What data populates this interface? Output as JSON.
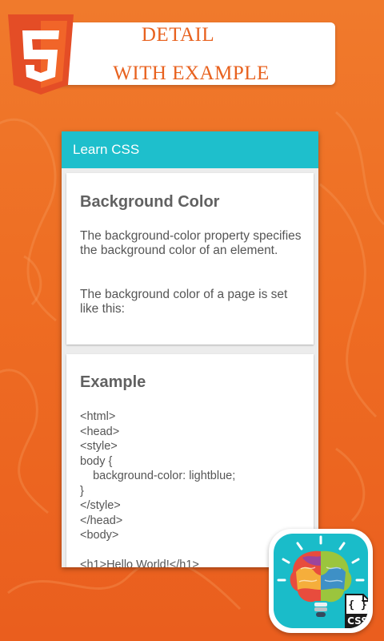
{
  "banner": {
    "line1": "DETAIL",
    "line2": "WITH EXAMPLE",
    "logo_icon": "html5-logo-icon",
    "logo_digit": "5"
  },
  "appbar": {
    "title": "Learn CSS"
  },
  "card_background": {
    "title": "Background Color",
    "paragraph1": "The background-color property specifies the background color of an element.",
    "paragraph2": "The background color of a page is set like this:"
  },
  "card_example": {
    "title": "Example",
    "code_lines": [
      "<html>",
      "<head>",
      "<style>",
      "body {",
      "    background-color: lightblue;",
      "}",
      "</style>",
      "</head>",
      "<body>",
      "",
      "<h1>Hello World!</h1>"
    ]
  },
  "badge": {
    "icon": "brain-lightbulb-icon",
    "file_icon": "css-file-icon",
    "file_label": "CSS",
    "file_braces": "{ }"
  },
  "colors": {
    "background": "#ee6d23",
    "banner_text": "#e8621f",
    "appbar": "#1ebfcc",
    "html5_orange": "#e44d26",
    "badge_teal": "#1abcc9"
  }
}
